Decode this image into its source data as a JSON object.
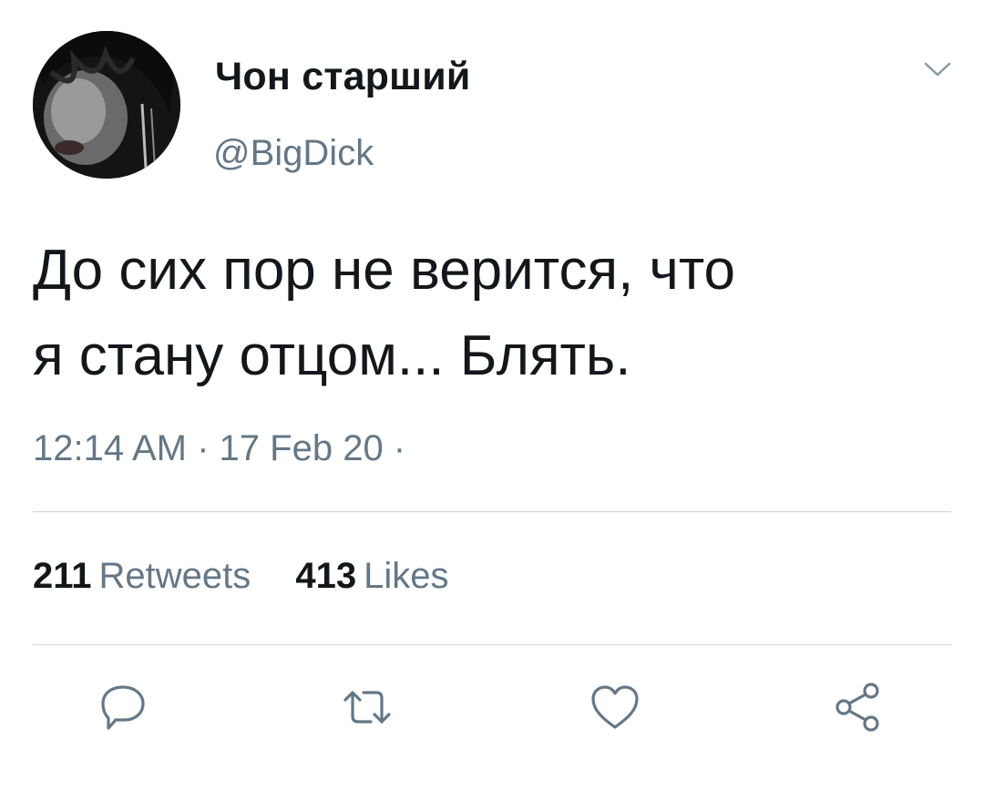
{
  "user": {
    "display_name": "Чон старший",
    "handle": "@BigDick"
  },
  "tweet": {
    "text_line1": "До сих пор не верится, что",
    "text_line2": "я стану отцом... Блять.",
    "timestamp": "12:14 AM · 17 Feb 20 ·"
  },
  "stats": {
    "retweets_count": "211",
    "retweets_label": "Retweets",
    "likes_count": "413",
    "likes_label": "Likes"
  },
  "icons": {
    "menu": "chevron-down-icon",
    "reply": "reply-icon",
    "retweet": "retweet-icon",
    "like": "heart-icon",
    "share": "share-icon"
  },
  "colors": {
    "text": "#14171a",
    "secondary": "#657786",
    "divider": "#ccd6dd",
    "background": "#ffffff"
  }
}
